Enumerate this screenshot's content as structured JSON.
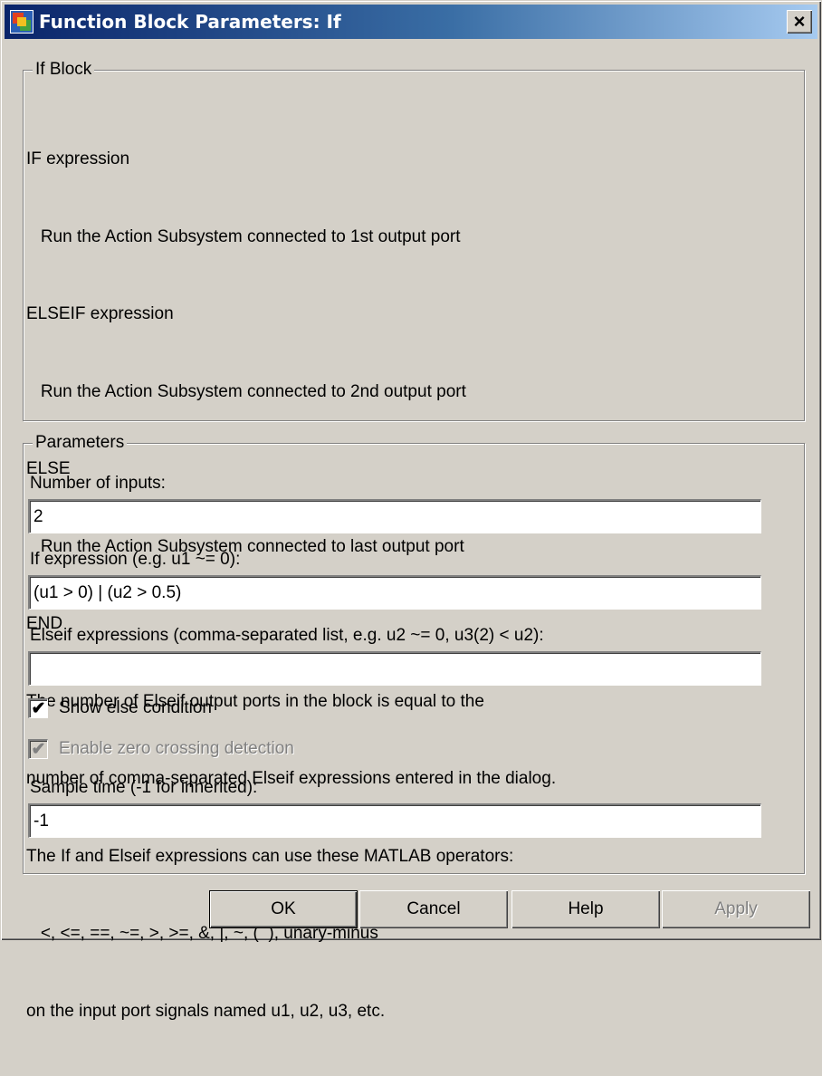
{
  "window": {
    "title": "Function Block Parameters: If",
    "close_label": "×"
  },
  "if_block": {
    "legend": "If Block",
    "lines": [
      "IF expression",
      "   Run the Action Subsystem connected to 1st output port",
      "ELSEIF expression",
      "   Run the Action Subsystem connected to 2nd output port",
      "ELSE",
      "   Run the Action Subsystem connected to last output port",
      "END",
      "The number of Elseif output ports in the block is equal to the",
      "number of comma-separated Elseif expressions entered in the dialog.",
      "The If and Elseif expressions can use these MATLAB operators:",
      "   <, <=, ==, ~=, >, >=, &, |, ~, (  ), unary-minus",
      "on the input port signals named u1, u2, u3, etc."
    ]
  },
  "parameters": {
    "legend": "Parameters",
    "num_inputs": {
      "label": "Number of inputs:",
      "value": "2"
    },
    "if_expression": {
      "label": "If expression (e.g. u1 ~= 0):",
      "value": "(u1 > 0) | (u2 > 0.5)"
    },
    "elseif_expressions": {
      "label": "Elseif expressions (comma-separated list, e.g. u2 ~= 0, u3(2) < u2):",
      "value": ""
    },
    "show_else": {
      "label": "Show else condition",
      "checked": true,
      "mark": "✔"
    },
    "zero_crossing": {
      "label": "Enable zero crossing detection",
      "checked": true,
      "enabled": false,
      "mark": "✔"
    },
    "sample_time": {
      "label": "Sample time (-1 for inherited):",
      "value": "-1"
    }
  },
  "buttons": {
    "ok": "OK",
    "cancel": "Cancel",
    "help": "Help",
    "apply": "Apply"
  },
  "colors": {
    "title_gradient_start": "#0a246a",
    "title_gradient_end": "#a6caf0",
    "face": "#d4d0c8"
  }
}
